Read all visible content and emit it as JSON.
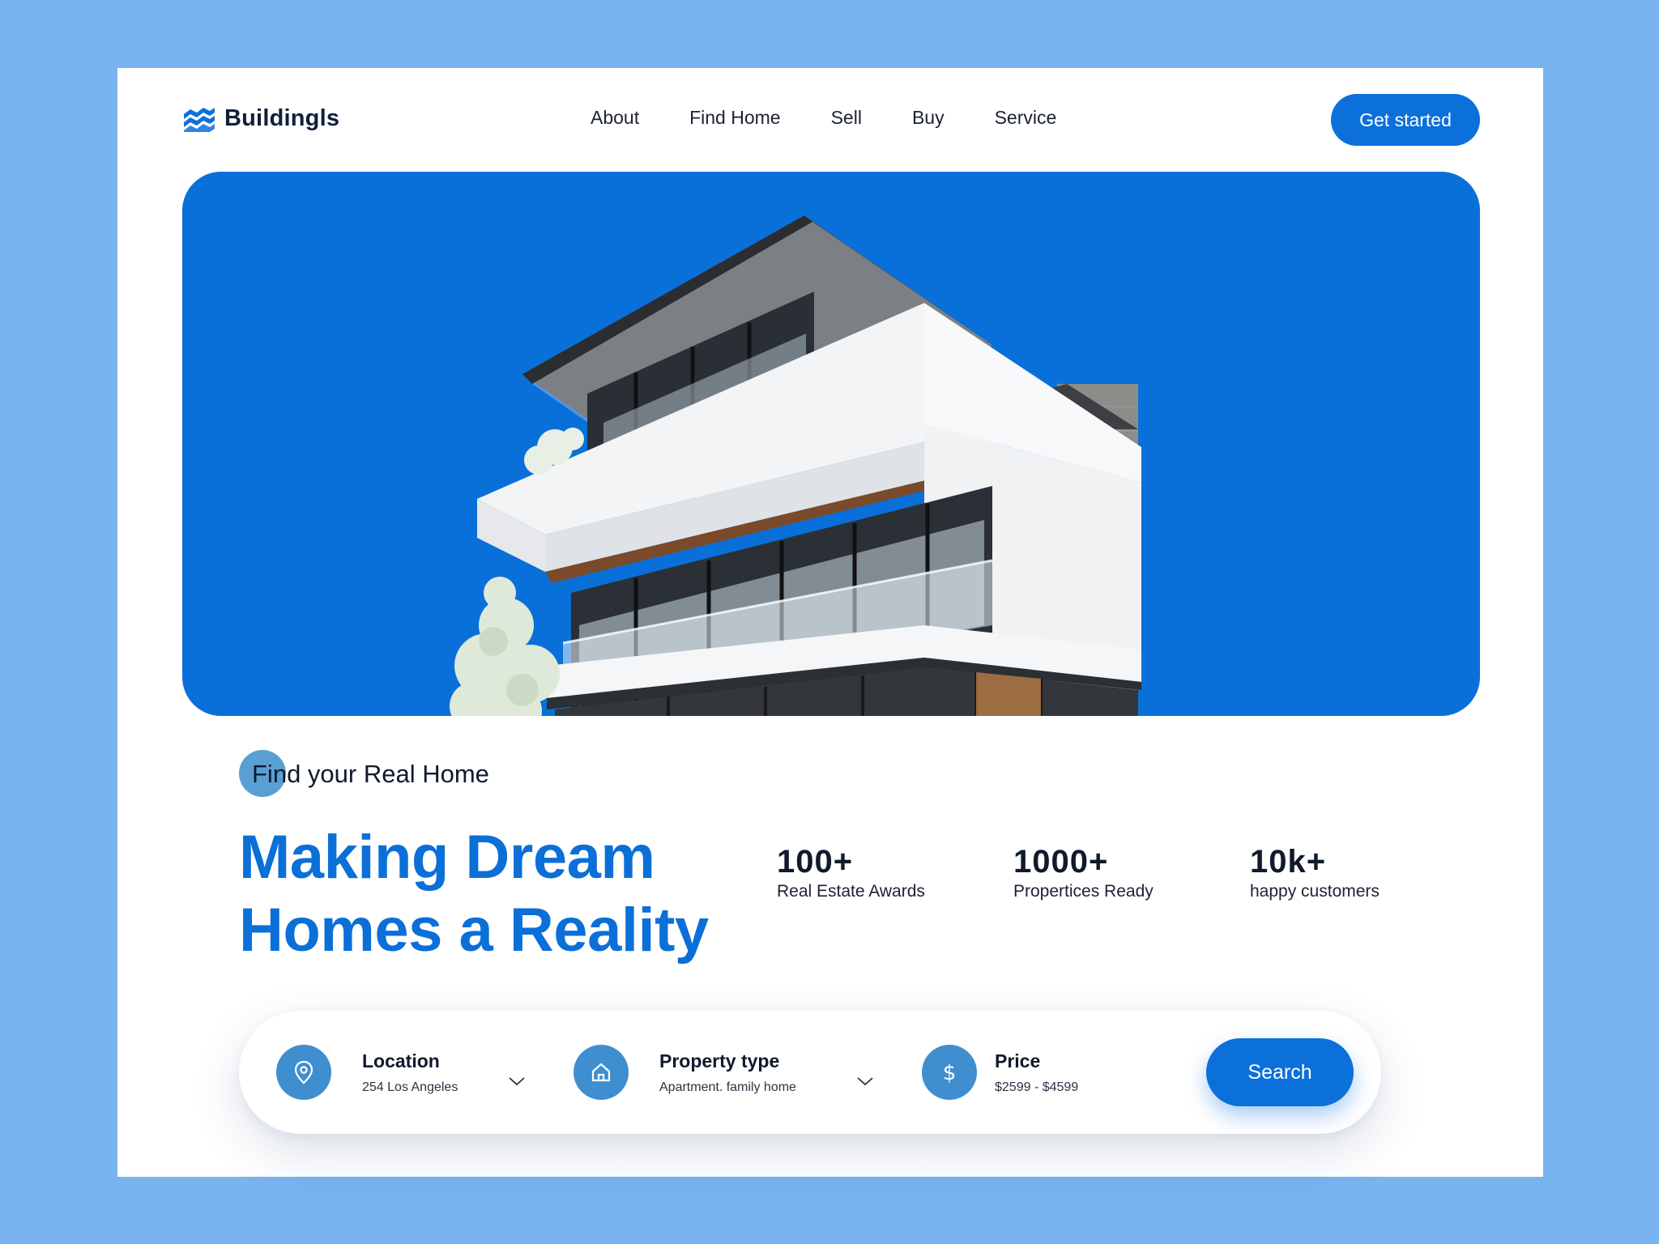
{
  "brand": {
    "name": "Buildingls",
    "accent": "#0b70da"
  },
  "nav": {
    "items": [
      "About",
      "Find Home",
      "Sell",
      "Buy",
      "Service"
    ]
  },
  "header": {
    "cta_label": "Get started"
  },
  "hero": {
    "image_icon": "modern-house-image",
    "background": "#0a70d9"
  },
  "intro": {
    "eyebrow": "Find your Real Home",
    "headline_line1": "Making Dream",
    "headline_line2": "Homes a Reality"
  },
  "stats": [
    {
      "value": "100+",
      "label": "Real Estate Awards"
    },
    {
      "value": "1000+",
      "label": "Propertices Ready"
    },
    {
      "value": "10k+",
      "label": "happy customers"
    }
  ],
  "search": {
    "location": {
      "label": "Location",
      "value": "254 Los Angeles",
      "icon": "map-pin-icon"
    },
    "property": {
      "label": "Property type",
      "value": "Apartment. family home",
      "icon": "home-icon"
    },
    "price": {
      "label": "Price",
      "value": "$2599 - $4599",
      "icon": "dollar-icon"
    },
    "button_label": "Search"
  }
}
